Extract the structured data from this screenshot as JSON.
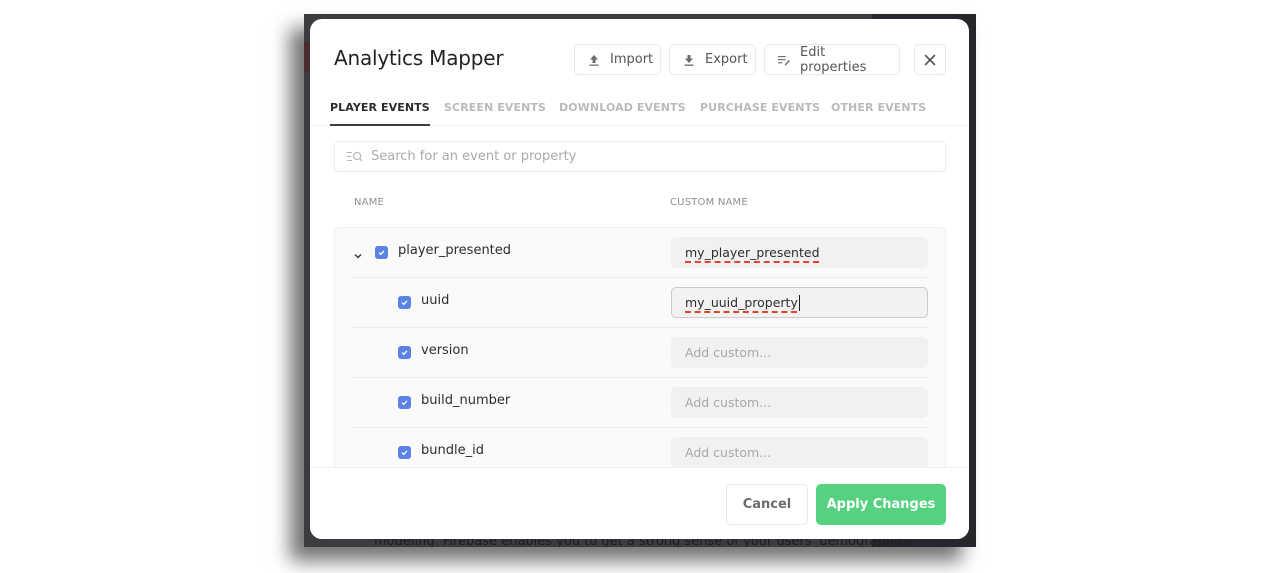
{
  "background": {
    "partial_text": "modeling. Firebase enables you to get a strong sense of your users' demographics"
  },
  "modal": {
    "title": "Analytics Mapper",
    "header_buttons": {
      "import": {
        "label": "Import",
        "icon": "upload-icon"
      },
      "export": {
        "label": "Export",
        "icon": "download-icon"
      },
      "edit_properties": {
        "label": "Edit properties",
        "icon": "edit-list-icon"
      },
      "close": {
        "icon": "close-icon"
      }
    },
    "tabs": [
      {
        "label": "PLAYER EVENTS",
        "active": true
      },
      {
        "label": "SCREEN EVENTS",
        "active": false
      },
      {
        "label": "DOWNLOAD EVENTS",
        "active": false
      },
      {
        "label": "PURCHASE EVENTS",
        "active": false
      },
      {
        "label": "OTHER EVENTS",
        "active": false
      }
    ],
    "search": {
      "placeholder": "Search for an event or property",
      "value": "",
      "icon": "filter-search-icon"
    },
    "columns": {
      "name": "NAME",
      "custom_name": "CUSTOM NAME"
    },
    "rows": [
      {
        "name": "player_presented",
        "checked": true,
        "expanded": true,
        "level": 0,
        "custom_name": "my_player_presented",
        "placeholder": "Add custom..."
      },
      {
        "name": "uuid",
        "checked": true,
        "level": 1,
        "custom_name": "my_uuid_property",
        "focused": true,
        "placeholder": "Add custom..."
      },
      {
        "name": "version",
        "checked": true,
        "level": 1,
        "custom_name": "",
        "placeholder": "Add custom..."
      },
      {
        "name": "build_number",
        "checked": true,
        "level": 1,
        "custom_name": "",
        "placeholder": "Add custom..."
      },
      {
        "name": "bundle_id",
        "checked": true,
        "level": 1,
        "custom_name": "",
        "placeholder": "Add custom..."
      }
    ],
    "footer": {
      "cancel_label": "Cancel",
      "apply_label": "Apply Changes"
    }
  },
  "colors": {
    "accent_blue": "#5b82e6",
    "apply_green": "#55d17f",
    "spellcheck_red": "#e0452c"
  }
}
